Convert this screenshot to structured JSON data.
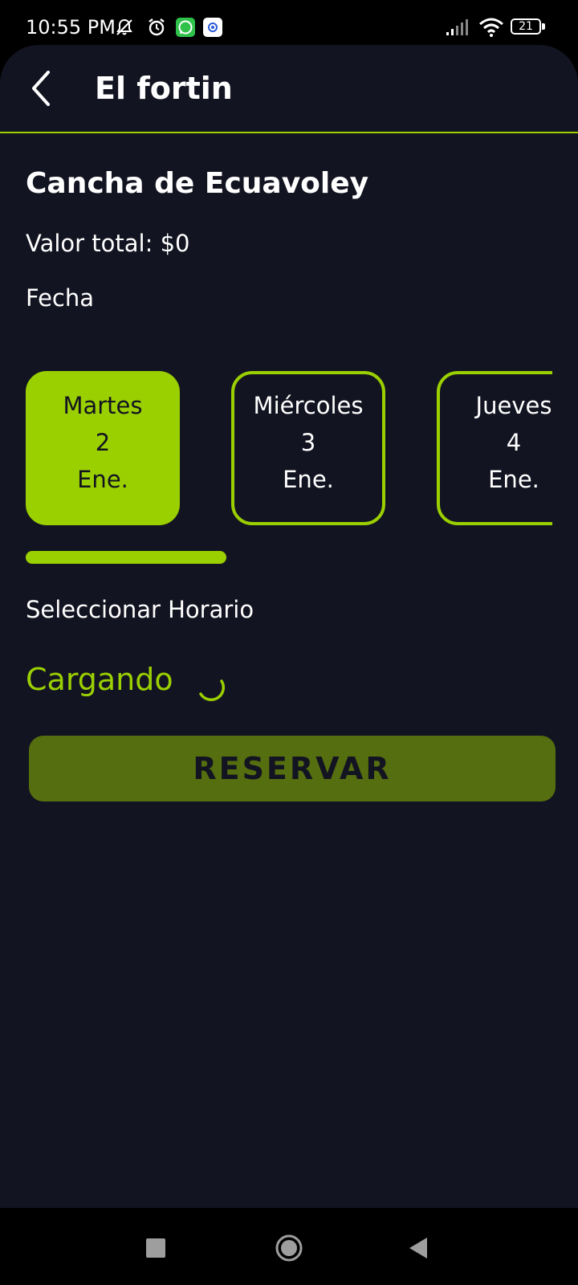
{
  "status_bar": {
    "time": "10:55 PM",
    "battery_level": "21",
    "icons": [
      "bell-off-icon",
      "alarm-icon",
      "whatsapp-icon",
      "app-notification-icon",
      "signal-icon",
      "wifi-icon",
      "battery-icon"
    ]
  },
  "header": {
    "back_icon": "chevron-left-icon",
    "title": "El fortin"
  },
  "venue": {
    "name": "Cancha de Ecuavoley",
    "total_label": "Valor total: $0"
  },
  "date_section": {
    "label": "Fecha",
    "chips": [
      {
        "day": "Martes",
        "number": "2",
        "month": "Ene.",
        "selected": true
      },
      {
        "day": "Miércoles",
        "number": "3",
        "month": "Ene.",
        "selected": false
      },
      {
        "day": "Jueves",
        "number": "4",
        "month": "Ene.",
        "selected": false
      }
    ]
  },
  "schedule": {
    "label": "Seleccionar Horario",
    "loading_text": "Cargando"
  },
  "actions": {
    "reserve_label": "RESERVAR"
  },
  "nav_bar": {
    "buttons": [
      "recents-square-icon",
      "home-circle-icon",
      "back-triangle-icon"
    ]
  },
  "colors": {
    "accent": "#9acf00",
    "background": "#131421",
    "button_disabled": "#556e0f",
    "text": "#ffffff"
  }
}
